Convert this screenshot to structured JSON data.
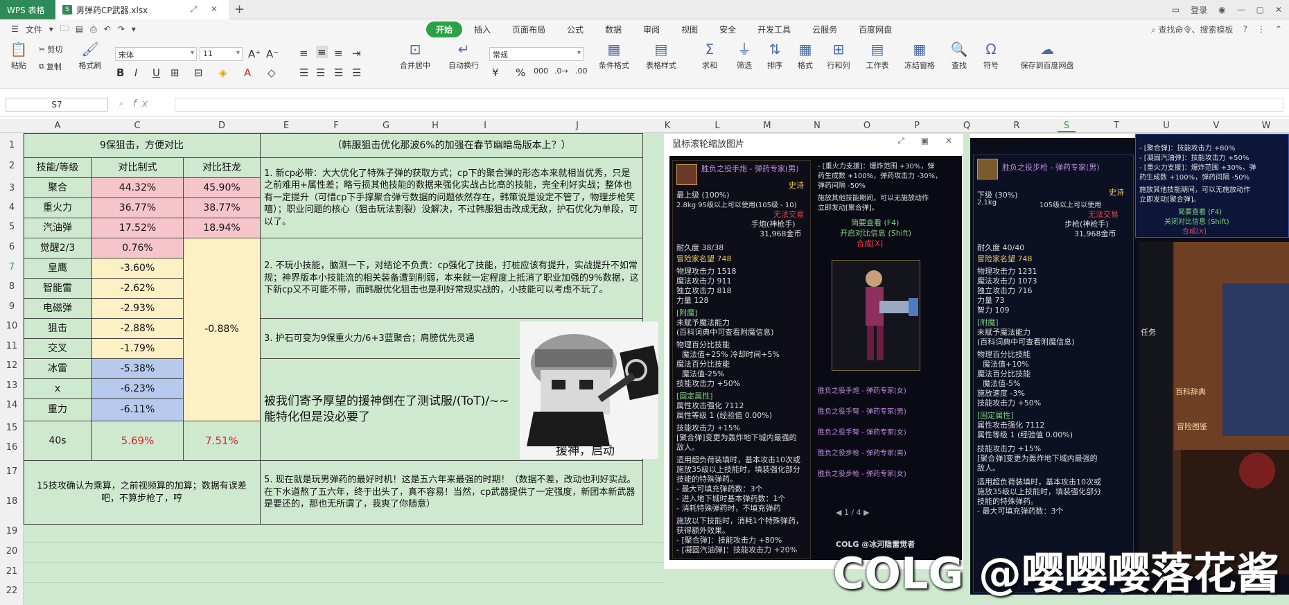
{
  "titlebar": {
    "app": "WPS 表格",
    "file": "男弹药CP武器.xlsx",
    "login": "登录"
  },
  "menu": {
    "file": "文件",
    "tabs": [
      "开始",
      "插入",
      "页面布局",
      "公式",
      "数据",
      "审阅",
      "视图",
      "安全",
      "开发工具",
      "云服务",
      "百度网盘"
    ],
    "search": "查找命令、搜索模板"
  },
  "ribbon": {
    "paste": "粘贴",
    "cut": "剪切",
    "copy": "复制",
    "format_painter": "格式刷",
    "font": "宋体",
    "size": "11",
    "merge": "合并居中",
    "wrap": "自动换行",
    "number_format": "常规",
    "cond": "条件格式",
    "table_style": "表格样式",
    "sum": "求和",
    "filter": "筛选",
    "sort": "排序",
    "fmt": "格式",
    "rowcol": "行和列",
    "sheet": "工作表",
    "freeze": "冻结窗格",
    "find": "查找",
    "symbol": "符号",
    "save_baidu": "保存到百度网盘"
  },
  "formula": {
    "cell": "S7",
    "fx": "fx"
  },
  "columns": [
    "A",
    "C",
    "D",
    "E",
    "F",
    "G",
    "H",
    "I",
    "J",
    "K",
    "L",
    "M",
    "N",
    "O",
    "P",
    "Q",
    "R",
    "S",
    "T",
    "U",
    "V",
    "W"
  ],
  "rows": [
    "1",
    "2",
    "3",
    "4",
    "5",
    "6",
    "7",
    "8",
    "9",
    "10",
    "11",
    "12",
    "13",
    "14",
    "15",
    "16",
    "17",
    "18",
    "19",
    "20",
    "21",
    "22"
  ],
  "sheet": {
    "title": "9保狙击，方便对比",
    "note_title": "（韩服狙击优化那波6%的加强在春节幽暗岛版本上？）",
    "headers": [
      "技能/等级",
      "对比制式",
      "对比狂龙"
    ],
    "skills": [
      {
        "name": "聚合",
        "c": "44.32%",
        "d": "45.90%"
      },
      {
        "name": "重火力",
        "c": "36.77%",
        "d": "38.77%"
      },
      {
        "name": "汽油弹",
        "c": "17.52%",
        "d": "18.94%"
      },
      {
        "name": "觉醒2/3",
        "c": "0.76%"
      },
      {
        "name": "皇鹰",
        "c": "-3.60%"
      },
      {
        "name": "智能雷",
        "c": "-2.62%"
      },
      {
        "name": "电磁弹",
        "c": "-2.93%"
      },
      {
        "name": "狙击",
        "c": "-2.88%"
      },
      {
        "name": "交叉",
        "c": "-1.79%"
      },
      {
        "name": "冰雷",
        "c": "-5.38%"
      },
      {
        "name": "x",
        "c": "-6.23%"
      },
      {
        "name": "重力",
        "c": "-6.11%"
      }
    ],
    "d_merged": "-0.88%",
    "total": {
      "name": "40s",
      "c": "5.69%",
      "d": "7.51%"
    },
    "footnote": "15技攻确认为乘算，之前视频算的加算；数据有误差吧，不算步枪了，哼",
    "notes": [
      "1. 新cp必带：大大优化了特殊子弹的获取方式；cp下的聚合弹的形态本来就相当优秀，只是之前难用+属性差；略亏损其他技能的数据来强化实战占比高的技能，完全利好实战；整体也有一定提升（可惜cp下手撑聚合弹亏数据的问题依然存在，韩策说是设定不管了，物理步枪笑嘻）；职业问题的核心（狙击玩法割裂）没解决，不过韩服狙击改成无敌，护石优化为单段，可以了。",
      "2. 不玩小技能，脑测一下，对结论不负责：cp强化了技能，打桩应该有提升，实战提升不如常规；神界版本小技能流的相关装备遭到削弱，本来就一定程度上抵消了职业加强的9%数据，这下新cp又不可能不带，而韩服优化狙击也是利好常规实战的，小技能可以考虑不玩了。",
      "3. 护石可变为9保重火力/6+3蓝聚合；肩膀优先灵通",
      "被我们寄予厚望的援神倒在了测试服/(ToT)/~~能特化但是没必要了",
      "5. 现在就是玩男弹药的最好时机！这是五六年来最强的时期！（数据不差，改动也利好实战。在下水道熬了五六年，终于出头了，真不容易！当然，cp武器提供了一定强度，新团本新武器是要还的，那也无所谓了，我爽了你随意）"
    ],
    "meme_caption": "援神，启动"
  },
  "popup": {
    "title": "鼠标滚轮缩放图片",
    "page": "1 / 4"
  },
  "item1": {
    "name": "胜负之役手炮 - 弹药专家(男)",
    "rarity": "史诗",
    "level": "最上级",
    "pct": "(100%)",
    "weight": "2.8kg",
    "req": "95级以上可以使用(105级 - 10)",
    "trade": "无法交易",
    "type": "手炮(神枪手)",
    "price": "31,968金币",
    "dur": "耐久度 38/38",
    "fame": "冒险家名望 748",
    "stats": [
      "物理攻击力 1518",
      "魔法攻击力 911",
      "独立攻击力 818",
      "力量 128"
    ],
    "enchant_h": "[附魔]",
    "enchant": "未赋予魔法能力",
    "enchant2": "(百科词典中可查看附魔信息)",
    "pct_h": "物理百分比技能",
    "pct_lines": [
      "魔法值+25% 冷却时间+5%",
      "魔法百分比技能",
      "魔法值-25%",
      "技能攻击力 +50%"
    ],
    "fixed_h": "[固定属性]",
    "fixed": [
      "属性攻击强化 7112",
      "属性等级 1 (经验值 0.00%)"
    ],
    "skill": "技能攻击力 +15%",
    "desc": [
      "[聚合弹]变更为轰炸地下城内最强的",
      "敌人。"
    ],
    "desc2": [
      "适用超负荷装填时，基本攻击10次或",
      "施放35级以上技能时，填装强化部分",
      "技能的特殊弹药。",
      "- 最大可填充弹药数：3个",
      "- 进入地下城时基本弹药数：1个",
      "- 消耗特殊弹药时，不填充弹药",
      "施放以下技能时，消耗1个特殊弹药，",
      "获得额外效果。",
      "- [聚合弹]：技能攻击力 +80%",
      "- [凝固汽油弹]：技能攻击力 +20%"
    ],
    "mid": [
      "- [重火力支援]：爆炸范围 +30%，弹",
      "药生成数 +100%，弹药攻击力 -30%，",
      "弹药间隔 -50%",
      "施放其他技能期间，可以无施放动作",
      "立即发动[聚合弹]。"
    ],
    "cmp": [
      "简要查看 (F4)",
      "开启对比信息 (Shift)",
      "合成[X]"
    ],
    "list": [
      "胜负之役手炮 - 弹药专家(女)",
      "胜负之役手弩 - 弹药专家(男)",
      "胜负之役手弩 - 弹药专家(女)",
      "胜负之役步枪 - 弹药专家(男)",
      "胜负之役步枪 - 弹药专家(女)"
    ],
    "colg": "COLG @冰河隐雷觉者"
  },
  "item2": {
    "name": "胜负之役步枪 - 弹药专家(男)",
    "rarity": "史诗",
    "level": "下级",
    "pct": "(30%)",
    "weight": "2.1kg",
    "req": "105级以上可以使用",
    "trade": "无法交易",
    "type": "步枪(神枪手)",
    "price": "31,968金币",
    "dur": "耐久度 40/40",
    "fame": "冒险家名望 748",
    "stats": [
      "物理攻击力 1231",
      "魔法攻击力 1073",
      "独立攻击力 716",
      "力量 73",
      "智力 109"
    ],
    "enchant_h": "[附魔]",
    "enchant": "未赋予魔法能力",
    "enchant2": "(百科词典中可查看附魔信息)",
    "pct_h": "物理百分比技能",
    "pct_lines": [
      "魔法值+10%",
      "魔法百分比技能",
      "魔法值-5%",
      "施放速度 -3%",
      "技能攻击力 +50%"
    ],
    "fixed_h": "[固定属性]",
    "fixed": [
      "属性攻击强化 7112",
      "属性等级 1 (经验值 0.00%)"
    ],
    "skill": "技能攻击力 +15%",
    "desc": [
      "[聚合弹]变更为轰炸地下城内最强的",
      "敌人。"
    ],
    "desc2": [
      "适用超负荷装填时，基本攻击10次或",
      "施放35级以上技能时，填装强化部分",
      "技能的特殊弹药。",
      "- 最大可填充弹药数：3个"
    ],
    "top": [
      "- [聚合弹]：技能攻击力 +80%",
      "- [凝固汽油弹]：技能攻击力 +50%",
      "- [重火力支援]：爆炸范围 +30%，弹",
      "药生成数 +100%，弹药间隔 -50%",
      "施放其他技能期间，可以无施放动作",
      "立即发动[聚合弹]。",
      "简要查看 (F4)",
      "关闭对比信息 (Shift)",
      "合成[X]"
    ],
    "side": [
      "任务",
      "百科辞典",
      "冒险图鉴"
    ]
  },
  "watermark": "COLG @嘤嘤嘤落花酱",
  "colors": {
    "green_tab": "#2ba245",
    "sheet_bg": "#cfe9cf",
    "pink": "#f6c5cc",
    "yellow": "#fdf0c4",
    "blue": "#b7c9ed"
  }
}
